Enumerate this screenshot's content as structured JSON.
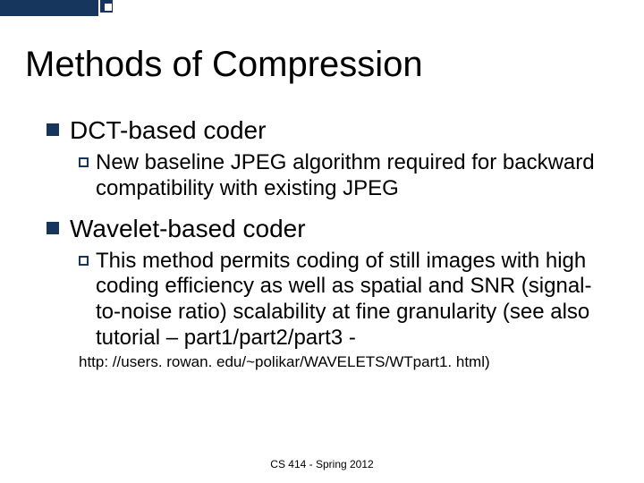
{
  "title": "Methods of Compression",
  "sections": [
    {
      "heading": "DCT-based coder",
      "sub_prefix": "New",
      "sub_rest": " baseline JPEG algorithm required for backward compatibility with existing JPEG"
    },
    {
      "heading": "Wavelet-based coder",
      "sub_prefix": "This",
      "sub_rest": " method permits coding of still images with high coding efficiency as well as spatial and SNR (signal-to-noise ratio) scalability at fine granularity (see also tutorial – part1/part2/part3 -"
    }
  ],
  "url_line": "http: //users. rowan. edu/~polikar/WAVELETS/WTpart1. html)",
  "footer": "CS 414 - Spring 2012"
}
